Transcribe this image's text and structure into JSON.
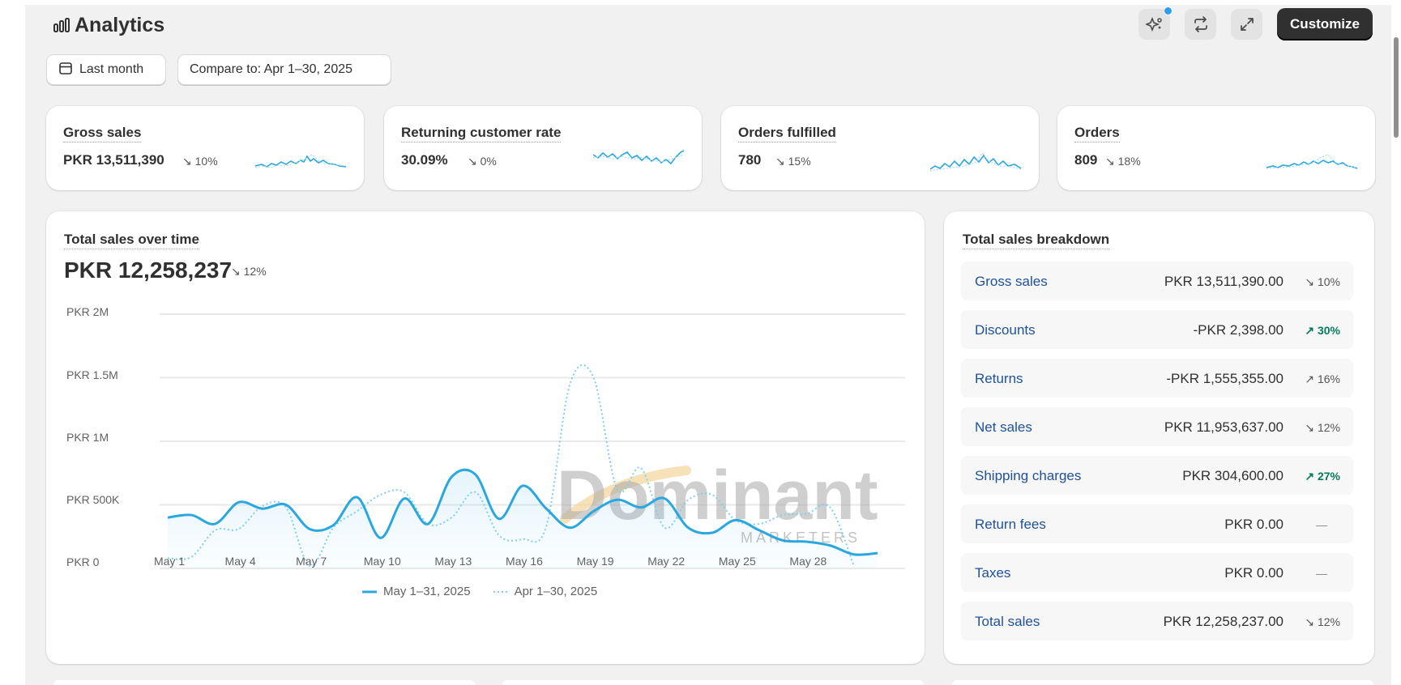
{
  "header": {
    "title": "Analytics",
    "customize_label": "Customize"
  },
  "icons": {
    "title_icon": "bar-chart-icon",
    "toolbar": [
      "sparkle-ai-icon",
      "refresh-icon",
      "expand-icon"
    ]
  },
  "filters": {
    "date_label": "Last month",
    "compare_label": "Compare to: Apr 1–30, 2025"
  },
  "metrics": [
    {
      "label": "Gross sales",
      "value": "PKR 13,511,390",
      "change": "↘ 10%",
      "direction": "down"
    },
    {
      "label": "Returning customer rate",
      "value": "30.09%",
      "change": "↘ 0%",
      "direction": "down"
    },
    {
      "label": "Orders fulfilled",
      "value": "780",
      "change": "↘ 15%",
      "direction": "down"
    },
    {
      "label": "Orders",
      "value": "809",
      "change": "↘ 18%",
      "direction": "down"
    }
  ],
  "sales_chart": {
    "title": "Total sales over time",
    "total": "PKR 12,258,237",
    "change": "↘ 12%"
  },
  "chart_data": {
    "type": "line",
    "x_labels": [
      "May 1",
      "May 4",
      "May 7",
      "May 10",
      "May 13",
      "May 16",
      "May 19",
      "May 22",
      "May 25",
      "May 28"
    ],
    "ylim": [
      0,
      2000000
    ],
    "y_ticks": [
      "PKR 0",
      "PKR 500K",
      "PKR 1M",
      "PKR 1.5M",
      "PKR 2M"
    ],
    "grid": true,
    "legend_position": "bottom",
    "series": [
      {
        "name": "May 1–31, 2025",
        "style": "solid",
        "color": "#2aa7df",
        "values": [
          400000,
          420000,
          350000,
          520000,
          470000,
          500000,
          310000,
          340000,
          560000,
          240000,
          550000,
          350000,
          720000,
          740000,
          390000,
          650000,
          470000,
          320000,
          450000,
          540000,
          480000,
          550000,
          320000,
          280000,
          380000,
          300000,
          220000,
          210000,
          180000,
          110000,
          120000
        ]
      },
      {
        "name": "Apr 1–30, 2025",
        "style": "dotted",
        "color": "#7fd0ea",
        "values": [
          80000,
          90000,
          300000,
          310000,
          490000,
          480000,
          20000,
          320000,
          450000,
          580000,
          600000,
          350000,
          400000,
          600000,
          260000,
          230000,
          330000,
          1450000,
          1500000,
          620000,
          790000,
          320000,
          540000,
          580000,
          380000,
          350000,
          420000,
          430000,
          480000,
          20000
        ]
      }
    ]
  },
  "breakdown": {
    "title": "Total sales breakdown",
    "rows": [
      {
        "label": "Gross sales",
        "value": "PKR 13,511,390.00",
        "change": "↘ 10%",
        "direction": "down"
      },
      {
        "label": "Discounts",
        "value": "-PKR 2,398.00",
        "change": "↗ 30%",
        "direction": "up"
      },
      {
        "label": "Returns",
        "value": "-PKR 1,555,355.00",
        "change": "↗ 16%",
        "direction": "neutral-up"
      },
      {
        "label": "Net sales",
        "value": "PKR 11,953,637.00",
        "change": "↘ 12%",
        "direction": "down"
      },
      {
        "label": "Shipping charges",
        "value": "PKR 304,600.00",
        "change": "↗ 27%",
        "direction": "up"
      },
      {
        "label": "Return fees",
        "value": "PKR 0.00",
        "change": "—",
        "direction": "none"
      },
      {
        "label": "Taxes",
        "value": "PKR 0.00",
        "change": "—",
        "direction": "none"
      },
      {
        "label": "Total sales",
        "value": "PKR 12,258,237.00",
        "change": "↘ 12%",
        "direction": "down"
      }
    ]
  },
  "watermark": {
    "brand": "Dominant",
    "tagline": "MARKETERS"
  },
  "colors": {
    "accent": "#2aa7df",
    "compare": "#7fd0ea",
    "positive": "#047b5d",
    "link": "#1f5199",
    "dark_button": "#303030"
  }
}
